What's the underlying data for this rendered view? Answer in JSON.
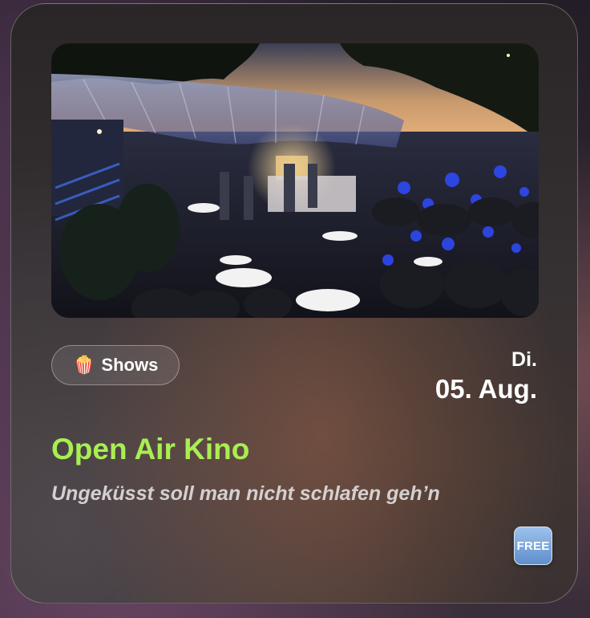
{
  "event": {
    "image_description_icon": "event-photo",
    "category": {
      "icon": "popcorn-icon",
      "icon_glyph": "🍿",
      "label": "Shows"
    },
    "weekday": "Di.",
    "date": "05. Aug.",
    "title": "Open Air Kino",
    "subtitle": "Ungeküsst soll man nicht schlafen geh’n",
    "price_badge": "FREE"
  },
  "colors": {
    "title": "#a8ef52",
    "subtitle": "#d4d0d0",
    "badge": "#6f9dd6"
  }
}
